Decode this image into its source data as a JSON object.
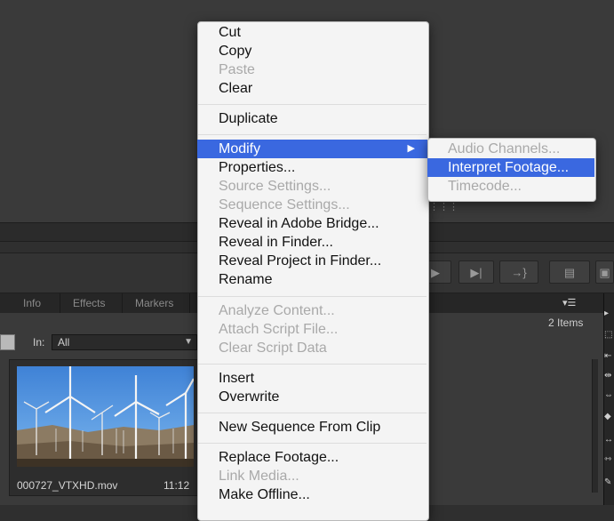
{
  "context_menu": {
    "items": [
      {
        "label": "Cut",
        "enabled": true
      },
      {
        "label": "Copy",
        "enabled": true
      },
      {
        "label": "Paste",
        "enabled": false
      },
      {
        "label": "Clear",
        "enabled": true
      },
      {
        "label": "Duplicate",
        "enabled": true
      },
      {
        "label": "Modify",
        "enabled": true,
        "highlighted": true,
        "submenu": true
      },
      {
        "label": "Properties...",
        "enabled": true
      },
      {
        "label": "Source Settings...",
        "enabled": false
      },
      {
        "label": "Sequence Settings...",
        "enabled": false
      },
      {
        "label": "Reveal in Adobe Bridge...",
        "enabled": true
      },
      {
        "label": "Reveal in Finder...",
        "enabled": true
      },
      {
        "label": "Reveal Project in Finder...",
        "enabled": true
      },
      {
        "label": "Rename",
        "enabled": true
      },
      {
        "label": "Analyze Content...",
        "enabled": false
      },
      {
        "label": "Attach Script File...",
        "enabled": false
      },
      {
        "label": "Clear Script Data",
        "enabled": false
      },
      {
        "label": "Insert",
        "enabled": true
      },
      {
        "label": "Overwrite",
        "enabled": true
      },
      {
        "label": "New Sequence From Clip",
        "enabled": true
      },
      {
        "label": "Replace Footage...",
        "enabled": true
      },
      {
        "label": "Link Media...",
        "enabled": false
      },
      {
        "label": "Make Offline...",
        "enabled": true
      }
    ]
  },
  "submenu": {
    "items": [
      {
        "label": "Audio Channels...",
        "enabled": false
      },
      {
        "label": "Interpret Footage...",
        "enabled": true,
        "highlighted": true
      },
      {
        "label": "Timecode...",
        "enabled": false
      }
    ]
  },
  "panel": {
    "tabs": [
      "Info",
      "Effects",
      "Markers"
    ],
    "items_count": "2 Items",
    "in_label": "In:",
    "in_value": "All",
    "clip": {
      "name": "000727_VTXHD.mov",
      "duration": "11:12"
    }
  },
  "colors": {
    "highlight": "#3a68e0",
    "menu_bg": "#f4f4f4",
    "app_bg": "#3a3a3a"
  }
}
